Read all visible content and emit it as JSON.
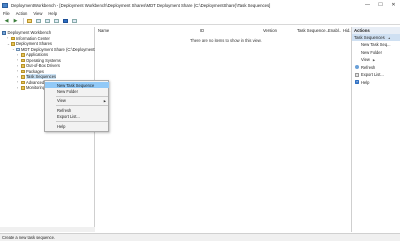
{
  "window": {
    "title": "DeploymentWorkbench - [Deployment Workbench\\Deployment Shares\\MDT Deployment Share (C:\\DeploymentShare)\\Task Sequences]",
    "minimize": "—",
    "maximize": "☐",
    "close": "✕"
  },
  "menu": [
    "File",
    "Action",
    "View",
    "Help"
  ],
  "tree": {
    "items": [
      {
        "label": "Deployment Workbench"
      },
      {
        "label": "Information Center"
      },
      {
        "label": "Deployment Shares"
      },
      {
        "label": "MDT Deployment Share (C:\\DeploymentShare)"
      },
      {
        "label": "Applications"
      },
      {
        "label": "Operating Systems"
      },
      {
        "label": "Out-of-Box Drivers"
      },
      {
        "label": "Packages"
      },
      {
        "label": "Task Sequences"
      },
      {
        "label": "Advanced Configuration"
      },
      {
        "label": "Monitoring"
      }
    ]
  },
  "list": {
    "columns": [
      "Name",
      "ID",
      "Version",
      "Task Sequence...",
      "Enabl..",
      "Hid.."
    ],
    "empty_message": "There are no items to show in this view."
  },
  "actions": {
    "header": "Actions",
    "section": "Task Sequences",
    "items": [
      "New Task Seq...",
      "New Folder",
      "View",
      "Refresh",
      "Export List...",
      "Help"
    ]
  },
  "context_menu": {
    "items": [
      "New Task Sequence",
      "New Folder",
      "View",
      "Refresh",
      "Export List...",
      "Help"
    ]
  },
  "status": {
    "text": "Create a new task sequence."
  },
  "colors": {
    "highlight": "#91c9f7",
    "actions_section": "#cfe0f2"
  }
}
